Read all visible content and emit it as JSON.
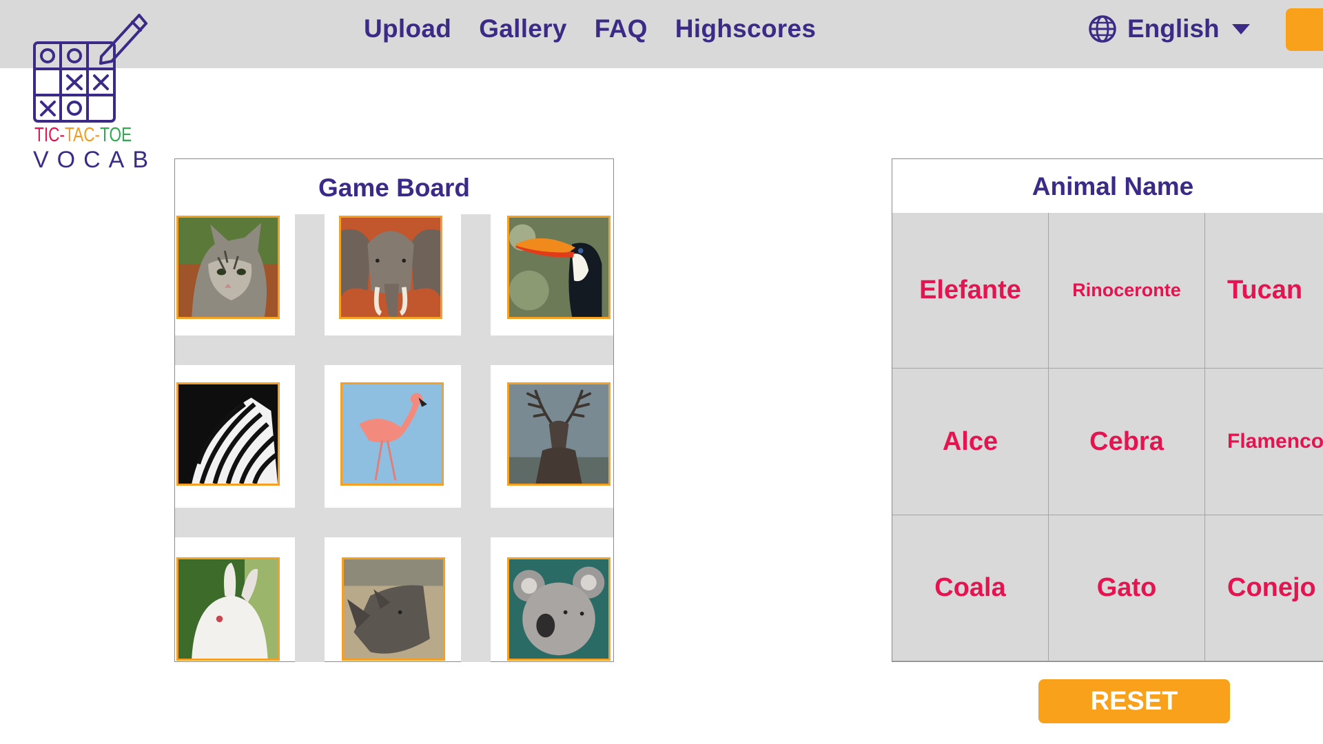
{
  "nav": {
    "links": [
      "Upload",
      "Gallery",
      "FAQ",
      "Highscores"
    ],
    "language": "English",
    "language_icon": "globe-icon"
  },
  "logo": {
    "line1": "TIC-TAC-TOE",
    "line2": "VOCAB",
    "colors": [
      "#e5134f",
      "#f39a1f",
      "#2fa84f",
      "#3b2a86"
    ]
  },
  "board": {
    "title": "Game Board",
    "cells": [
      {
        "animal": "cat"
      },
      {
        "animal": "elephant"
      },
      {
        "animal": "toucan"
      },
      {
        "animal": "zebra"
      },
      {
        "animal": "flamingo"
      },
      {
        "animal": "deer"
      },
      {
        "animal": "rabbit"
      },
      {
        "animal": "rhinoceros"
      },
      {
        "animal": "koala"
      }
    ]
  },
  "names": {
    "title": "Animal Name",
    "rows": [
      [
        "Elefante",
        "Rinoceronte",
        "Tucan"
      ],
      [
        "Alce",
        "Cebra",
        "Flamenco"
      ],
      [
        "Coala",
        "Gato",
        "Conejo"
      ]
    ]
  },
  "reset_label": "RESET",
  "colors": {
    "accent": "#f9a11b",
    "nav_text": "#3b2a86",
    "name_text": "#e5134f",
    "topbar": "#d9d9d9"
  }
}
